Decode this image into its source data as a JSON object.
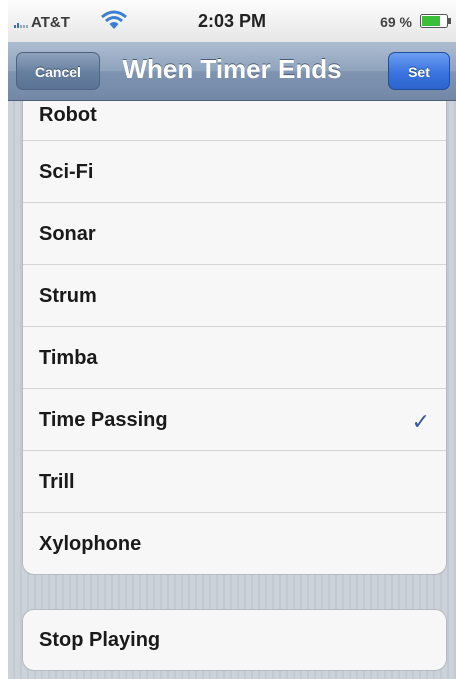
{
  "status_bar": {
    "carrier": "AT&T",
    "time": "2:03 PM",
    "battery": "69 %"
  },
  "nav_bar": {
    "cancel_label": "Cancel",
    "title": "When Timer Ends",
    "set_label": "Set"
  },
  "sounds": [
    {
      "label": "Robot",
      "selected": false
    },
    {
      "label": "Sci-Fi",
      "selected": false
    },
    {
      "label": "Sonar",
      "selected": false
    },
    {
      "label": "Strum",
      "selected": false
    },
    {
      "label": "Timba",
      "selected": false
    },
    {
      "label": "Time Passing",
      "selected": true
    },
    {
      "label": "Trill",
      "selected": false
    },
    {
      "label": "Xylophone",
      "selected": false
    }
  ],
  "stop_playing_label": "Stop Playing",
  "checkmark_glyph": "✓",
  "colors": {
    "nav_bar": "#8399b6",
    "set_button": "#3a74e0",
    "checkmark": "#3b5a96"
  }
}
